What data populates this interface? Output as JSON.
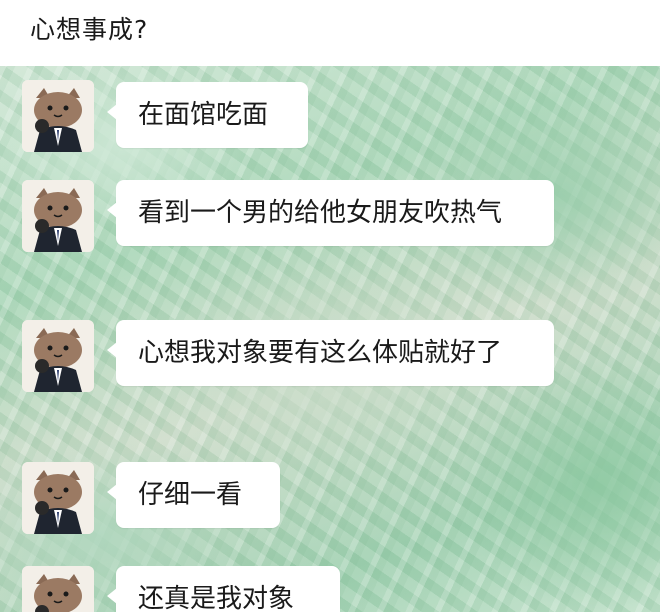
{
  "post": {
    "title": "心想事成?"
  },
  "chat": {
    "messages": [
      {
        "sender": "cat-avatar",
        "text": "在面馆吃面"
      },
      {
        "sender": "cat-avatar",
        "text": "看到一个男的给他女朋友吹热气"
      },
      {
        "sender": "cat-avatar",
        "text": "心想我对象要有这么体贴就好了"
      },
      {
        "sender": "cat-avatar",
        "text": "仔细一看"
      },
      {
        "sender": "cat-avatar",
        "text": "还真是我对象"
      }
    ]
  },
  "colors": {
    "bubble": "#ffffff",
    "text": "#1a1a1a",
    "chat_background": "#a9d6b7"
  },
  "icons": {
    "avatar": "cat-in-suit-avatar-icon"
  }
}
